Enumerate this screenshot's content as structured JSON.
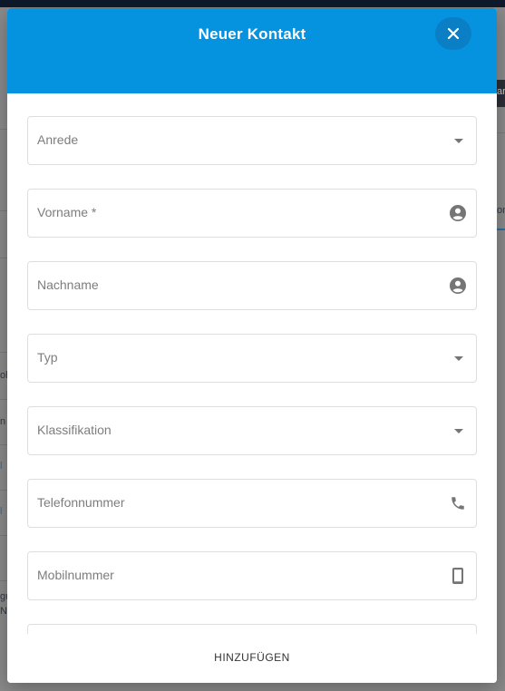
{
  "dialog": {
    "title": "Neuer Kontakt",
    "close_icon": "close-icon",
    "submit_label": "HINZUFÜGEN"
  },
  "fields": [
    {
      "label": "Anrede",
      "type": "select",
      "icon": "chevron-down-icon"
    },
    {
      "label": "Vorname *",
      "type": "text",
      "icon": "account-circle-icon"
    },
    {
      "label": "Nachname",
      "type": "text",
      "icon": "account-circle-icon"
    },
    {
      "label": "Typ",
      "type": "select",
      "icon": "chevron-down-icon"
    },
    {
      "label": "Klassifikation",
      "type": "select",
      "icon": "chevron-down-icon"
    },
    {
      "label": "Telefonnummer",
      "type": "text",
      "icon": "phone-icon"
    },
    {
      "label": "Mobilnummer",
      "type": "text",
      "icon": "smartphone-icon"
    }
  ],
  "background": {
    "fragments": [
      "ar",
      "on",
      "oh",
      "n",
      "l",
      "l",
      "gu",
      "N"
    ]
  },
  "colors": {
    "header": "#0593e0",
    "close_button": "#0a7fc5",
    "field_border": "#dedede",
    "label": "#7d7d7d",
    "icon": "#757575"
  }
}
